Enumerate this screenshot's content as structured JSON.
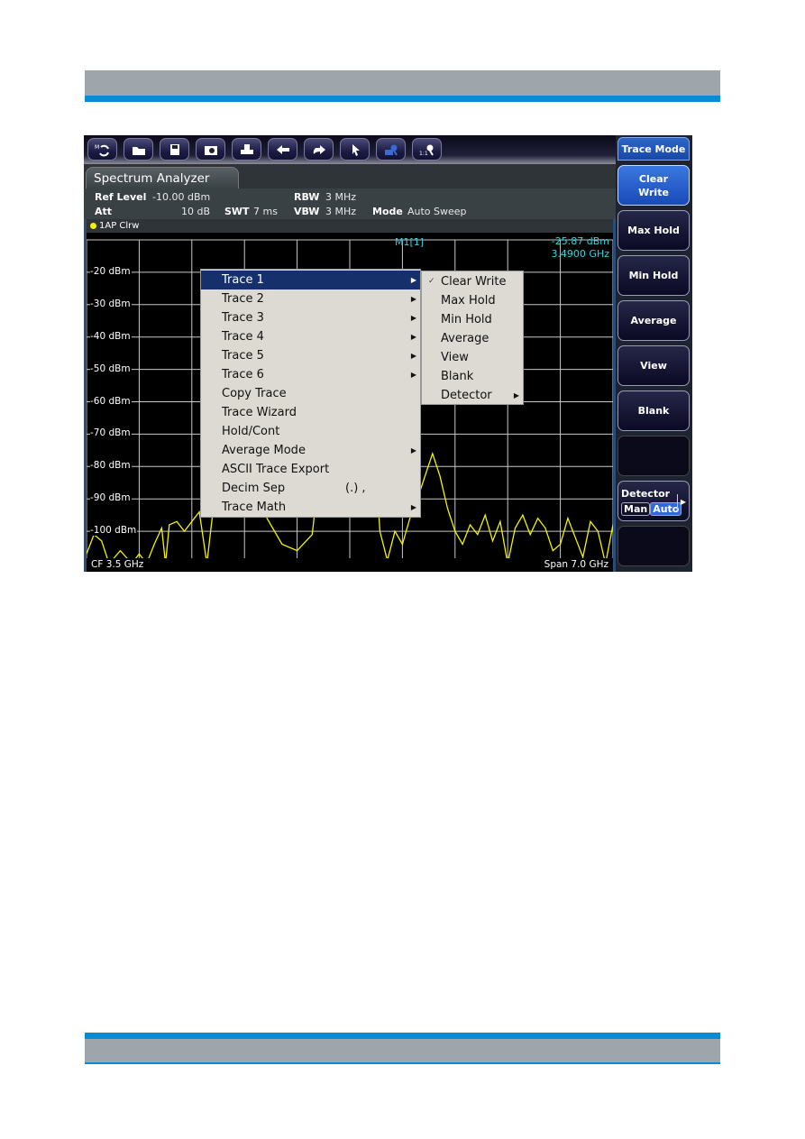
{
  "page": {
    "header_colors": {
      "gray": "#9ea6ab",
      "blue": "#0d8bd1"
    }
  },
  "toolbar": {
    "buttons": [
      {
        "icon": "mode-switch-icon"
      },
      {
        "icon": "open-folder-icon"
      },
      {
        "icon": "save-disk-icon"
      },
      {
        "icon": "camera-screenshot-icon"
      },
      {
        "icon": "printer-icon"
      },
      {
        "icon": "undo-icon"
      },
      {
        "icon": "redo-icon"
      },
      {
        "icon": "pointer-icon"
      },
      {
        "icon": "zoom-mode-icon"
      },
      {
        "icon": "zoom-reset-icon",
        "label": "1:1"
      }
    ]
  },
  "tab": {
    "label": "Spectrum Analyzer"
  },
  "info": {
    "ref_level_label": "Ref Level",
    "ref_level_value": "-10.00 dBm",
    "att_label": "Att",
    "att_value": "10 dB",
    "swt_label": "SWT",
    "swt_value": "7 ms",
    "rbw_label": "RBW",
    "rbw_value": "3 MHz",
    "vbw_label": "VBW",
    "vbw_value": "3 MHz",
    "mode_label": "Mode",
    "mode_value": "Auto Sweep"
  },
  "diagram": {
    "trace_label": "1AP Clrw",
    "marker_name": "M1[1]",
    "marker_level": "-25.87 dBm",
    "marker_freq": "3.4900 GHz",
    "cf": "CF 3.5 GHz",
    "span": "Span 7.0 GHz",
    "trace_color": "#f2f20a",
    "marker_color": "#35d3e0"
  },
  "chart_data": {
    "type": "line",
    "title": "1AP Clrw",
    "xlabel": "",
    "ylabel": "",
    "x_range_ghz": [
      0,
      7.0
    ],
    "ylim": [
      -110,
      -10
    ],
    "yticks": [
      -20,
      -30,
      -40,
      -50,
      -60,
      -70,
      -80,
      -90,
      -100
    ],
    "ytick_labels": [
      "-20 dBm",
      "-30 dBm",
      "-40 dBm",
      "-50 dBm",
      "-60 dBm",
      "-70 dBm",
      "-80 dBm",
      "-90 dBm",
      "-100 dBm"
    ],
    "grid": true,
    "series": [
      {
        "name": "Trace 1",
        "x": [
          0.0,
          0.1,
          0.2,
          0.3,
          0.45,
          0.6,
          0.7,
          0.8,
          0.9,
          1.0,
          1.05,
          1.1,
          1.2,
          1.3,
          1.4,
          1.5,
          1.6,
          1.7,
          1.8,
          1.9,
          2.0,
          2.1,
          2.2,
          2.3,
          2.4,
          2.6,
          2.8,
          3.0,
          3.2,
          3.4,
          3.49,
          3.6,
          3.8,
          3.9,
          4.0,
          4.1,
          4.2,
          4.3,
          4.4,
          4.5,
          4.6,
          4.7,
          4.8,
          4.9,
          5.0,
          5.1,
          5.2,
          5.3,
          5.4,
          5.5,
          5.6,
          5.7,
          5.8,
          5.9,
          6.0,
          6.1,
          6.2,
          6.3,
          6.4,
          6.5,
          6.6,
          6.7,
          6.8,
          6.9,
          7.0
        ],
        "values": [
          -107,
          -101,
          -103,
          -110,
          -106,
          -110,
          -107,
          -110,
          -104,
          -99,
          -110,
          -98,
          -97,
          -100,
          -97,
          -94,
          -110,
          -90,
          -85,
          -79,
          -76,
          -77,
          -81,
          -88,
          -96,
          -104,
          -106,
          -101,
          -60,
          -30,
          -25.87,
          -30,
          -62,
          -100,
          -109,
          -100,
          -104,
          -96,
          -90,
          -83,
          -76,
          -83,
          -93,
          -100,
          -104,
          -98,
          -101,
          -95,
          -103,
          -97,
          -110,
          -99,
          -95,
          -101,
          -96,
          -99,
          -106,
          -104,
          -96,
          -102,
          -108,
          -97,
          -100,
          -110,
          -98
        ]
      }
    ]
  },
  "context_menu": {
    "items": [
      {
        "label": "Trace 1",
        "submenu": true,
        "highlighted": true
      },
      {
        "label": "Trace 2",
        "submenu": true
      },
      {
        "label": "Trace 3",
        "submenu": true
      },
      {
        "label": "Trace 4",
        "submenu": true
      },
      {
        "label": "Trace 5",
        "submenu": true
      },
      {
        "label": "Trace 6",
        "submenu": true
      },
      {
        "label": "Copy Trace"
      },
      {
        "label": "Trace Wizard"
      },
      {
        "label": "Hold/Cont"
      },
      {
        "label": "Average Mode",
        "submenu": true
      },
      {
        "label": "ASCII Trace Export"
      },
      {
        "label": "Decim Sep",
        "extra": "(.) ,"
      },
      {
        "label": "Trace Math",
        "submenu": true
      }
    ]
  },
  "submenu": {
    "items": [
      {
        "label": "Clear Write",
        "checked": true
      },
      {
        "label": "Max Hold"
      },
      {
        "label": "Min Hold"
      },
      {
        "label": "Average"
      },
      {
        "label": "View"
      },
      {
        "label": "Blank"
      },
      {
        "label": "Detector",
        "submenu": true
      }
    ]
  },
  "softkeys": {
    "title": "Trace Mode",
    "keys": [
      {
        "label": "Clear Write",
        "active": true
      },
      {
        "label": "Max Hold"
      },
      {
        "label": "Min Hold"
      },
      {
        "label": "Average"
      },
      {
        "label": "View"
      },
      {
        "label": "Blank"
      },
      {
        "label": ""
      },
      {
        "label": "Detector",
        "options": [
          "Man",
          "Auto"
        ],
        "selected": "Auto"
      },
      {
        "label": ""
      }
    ]
  }
}
